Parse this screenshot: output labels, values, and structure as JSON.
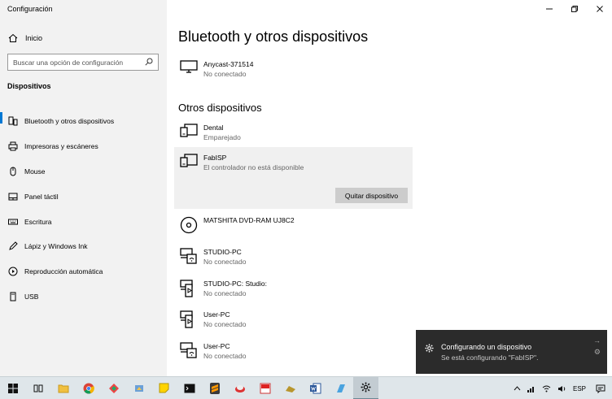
{
  "window": {
    "title": "Configuración",
    "controls": [
      "minimize-icon",
      "restore-icon",
      "close-icon"
    ]
  },
  "sidebar": {
    "home_label": "Inicio",
    "search_placeholder": "Buscar una opción de configuración",
    "section_label": "Dispositivos",
    "items": [
      {
        "label": "Bluetooth y otros dispositivos",
        "icon": "bluetooth-devices-icon",
        "active": true
      },
      {
        "label": "Impresoras y escáneres",
        "icon": "printer-icon"
      },
      {
        "label": "Mouse",
        "icon": "mouse-icon"
      },
      {
        "label": "Panel táctil",
        "icon": "touchpad-icon"
      },
      {
        "label": "Escritura",
        "icon": "keyboard-icon"
      },
      {
        "label": "Lápiz y Windows Ink",
        "icon": "pen-icon"
      },
      {
        "label": "Reproducción automática",
        "icon": "autoplay-icon"
      },
      {
        "label": "USB",
        "icon": "usb-icon"
      }
    ]
  },
  "main": {
    "title": "Bluetooth y otros dispositivos",
    "first_device": {
      "name": "Anycast-371514",
      "status": "No conectado",
      "icon": "monitor-icon"
    },
    "other_heading": "Otros dispositivos",
    "other_devices": [
      {
        "name": "Dental",
        "status": "Emparejado",
        "icon": "device-icon"
      },
      {
        "name": "FabISP",
        "status": "El controlador no está disponible",
        "icon": "device-icon",
        "selected": true,
        "button": "Quitar dispositivo"
      },
      {
        "name": "MATSHITA DVD-RAM UJ8C2",
        "status": "",
        "icon": "disc-icon"
      },
      {
        "name": "STUDIO-PC",
        "status": "No conectado",
        "icon": "network-device-icon"
      },
      {
        "name": "STUDIO-PC: Studio:",
        "status": "No conectado",
        "icon": "media-device-icon"
      },
      {
        "name": "User-PC",
        "status": "No conectado",
        "icon": "media-device-icon"
      },
      {
        "name": "User-PC",
        "status": "No conectado",
        "icon": "network-device-icon"
      }
    ]
  },
  "toast": {
    "title": "Configurando un dispositivo",
    "body": "Se está configurando \"FabISP\".",
    "icon": "gear-icon"
  },
  "taskbar": {
    "apps": [
      "windows-start-icon",
      "task-view-icon",
      "file-explorer-icon",
      "chrome-icon",
      "app-icon",
      "app-icon",
      "sticky-notes-icon",
      "terminal-icon",
      "sublime-icon",
      "app-icon",
      "app-icon",
      "app-icon",
      "word-icon",
      "app-icon",
      "settings-icon"
    ],
    "tray": {
      "language": "ESP"
    }
  }
}
